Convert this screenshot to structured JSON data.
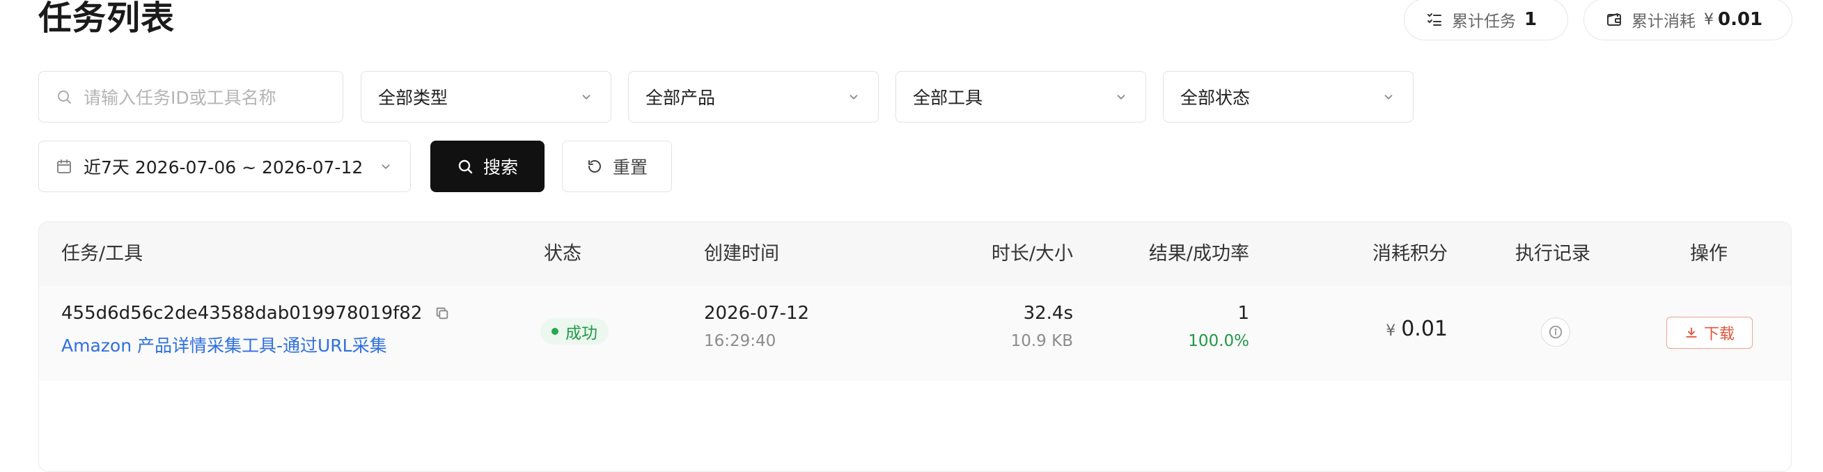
{
  "header": {
    "title": "任务列表",
    "total_tasks_label": "累计任务",
    "total_tasks_value": "1",
    "total_cost_label": "累计消耗",
    "total_cost_currency": "¥",
    "total_cost_value": "0.01"
  },
  "filters": {
    "search_placeholder": "请输入任务ID或工具名称",
    "type_select": "全部类型",
    "product_select": "全部产品",
    "tool_select": "全部工具",
    "status_select": "全部状态",
    "date_range": "近7天 2026-07-06 ~ 2026-07-12",
    "search_button": "搜索",
    "reset_button": "重置"
  },
  "table": {
    "columns": [
      "任务/工具",
      "状态",
      "创建时间",
      "时长/大小",
      "结果/成功率",
      "消耗积分",
      "执行记录",
      "操作"
    ],
    "rows": [
      {
        "task_id": "455d6d56c2de43588dab019978019f82",
        "tool_name": "Amazon 产品详情采集工具-通过URL采集",
        "status": "成功",
        "created_date": "2026-07-12",
        "created_time": "16:29:40",
        "duration": "32.4s",
        "size": "10.9 KB",
        "result": "1",
        "success_rate": "100.0%",
        "cost_currency": "¥",
        "cost": "0.01",
        "download_label": "下载"
      }
    ]
  },
  "colors": {
    "primary_button": "#111111",
    "link": "#2f6fe0",
    "success": "#1f9a44",
    "download": "#e5533a"
  }
}
